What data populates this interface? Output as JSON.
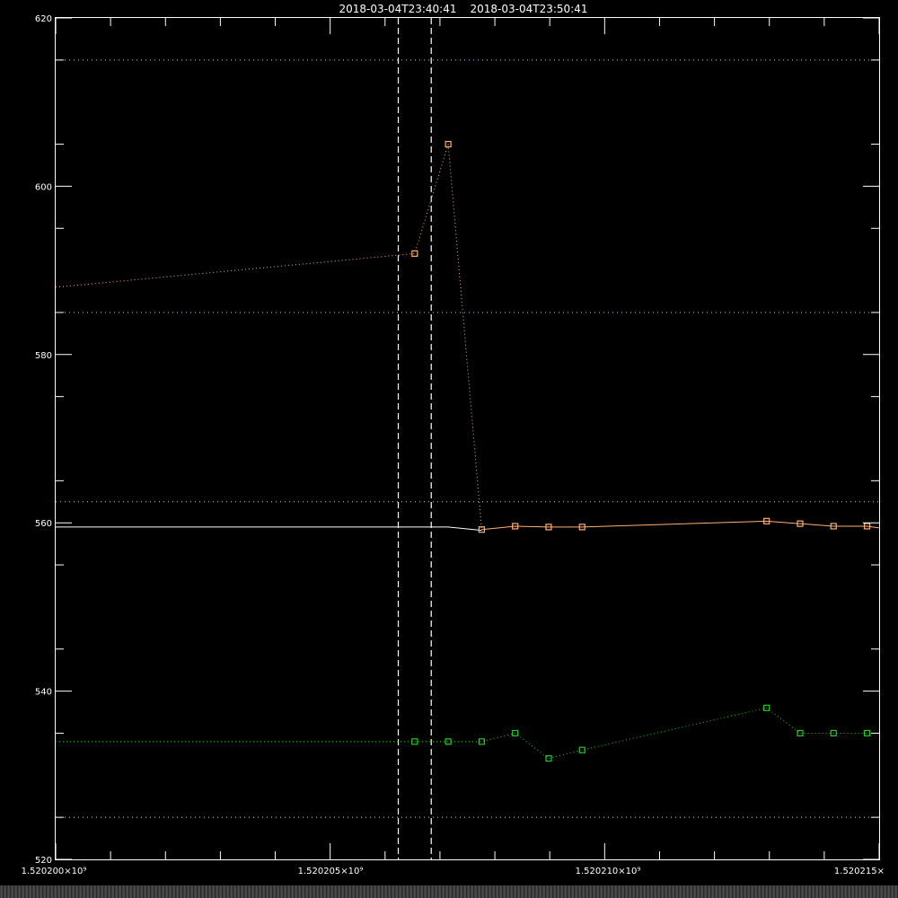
{
  "chart_data": {
    "type": "line",
    "title_start": "2018-03-04T23:40:41",
    "title_end": "2018-03-04T23:50:41",
    "x_tick_labels": [
      "1.520200×10⁹",
      "1.520205×10⁹",
      "1.520210×10⁹",
      "1.520215×"
    ],
    "x_ticks": [
      1520200000,
      1520205000,
      1520210000,
      1520215000
    ],
    "y_tick_labels": [
      "520",
      "540",
      "560",
      "580",
      "600",
      "620"
    ],
    "y_ticks": [
      520,
      540,
      560,
      580,
      600,
      620
    ],
    "xlim": [
      1520200000,
      1520215000
    ],
    "ylim": [
      520,
      620
    ],
    "vlines": [
      1520206241,
      1520206841
    ],
    "hlines_dotted": [
      615,
      585,
      562.5,
      525
    ],
    "series": [
      {
        "color": "#ffb070",
        "style": "dotted",
        "x": [
          1520200000,
          1520206540,
          1520207150
        ],
        "y": [
          588,
          592,
          605
        ]
      },
      {
        "color": "#ffb070",
        "style": "dotted",
        "x": [
          1520207150,
          1520207760
        ],
        "y": [
          605,
          559.2
        ]
      },
      {
        "color": "#ffb070",
        "style": "solid",
        "x": [
          1520207760,
          1520208370,
          1520208980,
          1520209590,
          1520212950,
          1520213560,
          1520214170,
          1520214780,
          1520215000
        ],
        "y": [
          559.2,
          559.6,
          559.5,
          559.5,
          560.2,
          559.9,
          559.6,
          559.6,
          559.4
        ]
      },
      {
        "color": "#ffffff",
        "style": "solid",
        "x": [
          1520200000,
          1520206540,
          1520207150,
          1520207760
        ],
        "y": [
          559.5,
          559.5,
          559.5,
          559.1
        ]
      },
      {
        "color": "#22cc22",
        "style": "dotted",
        "x": [
          1520200000,
          1520206540,
          1520207150,
          1520207760,
          1520208370,
          1520208980,
          1520209590,
          1520212950,
          1520213560,
          1520214170,
          1520214780,
          1520215000
        ],
        "y": [
          534,
          534,
          534,
          534,
          535,
          532,
          533,
          538,
          535,
          535,
          535,
          535
        ]
      }
    ],
    "markers": [
      {
        "color": "#ffb070",
        "x": [
          1520206540,
          1520207150,
          1520207760,
          1520208370,
          1520208980,
          1520209590,
          1520212950,
          1520213560,
          1520214170,
          1520214780
        ],
        "y": [
          592,
          605,
          559.2,
          559.6,
          559.5,
          559.5,
          560.2,
          559.9,
          559.6,
          559.6
        ]
      },
      {
        "color": "#22cc22",
        "x": [
          1520206540,
          1520207150,
          1520207760,
          1520208370,
          1520208980,
          1520209590,
          1520212950,
          1520213560,
          1520214170,
          1520214780
        ],
        "y": [
          534,
          534,
          534,
          535,
          532,
          533,
          538,
          535,
          535,
          535
        ]
      }
    ],
    "grid": false
  }
}
